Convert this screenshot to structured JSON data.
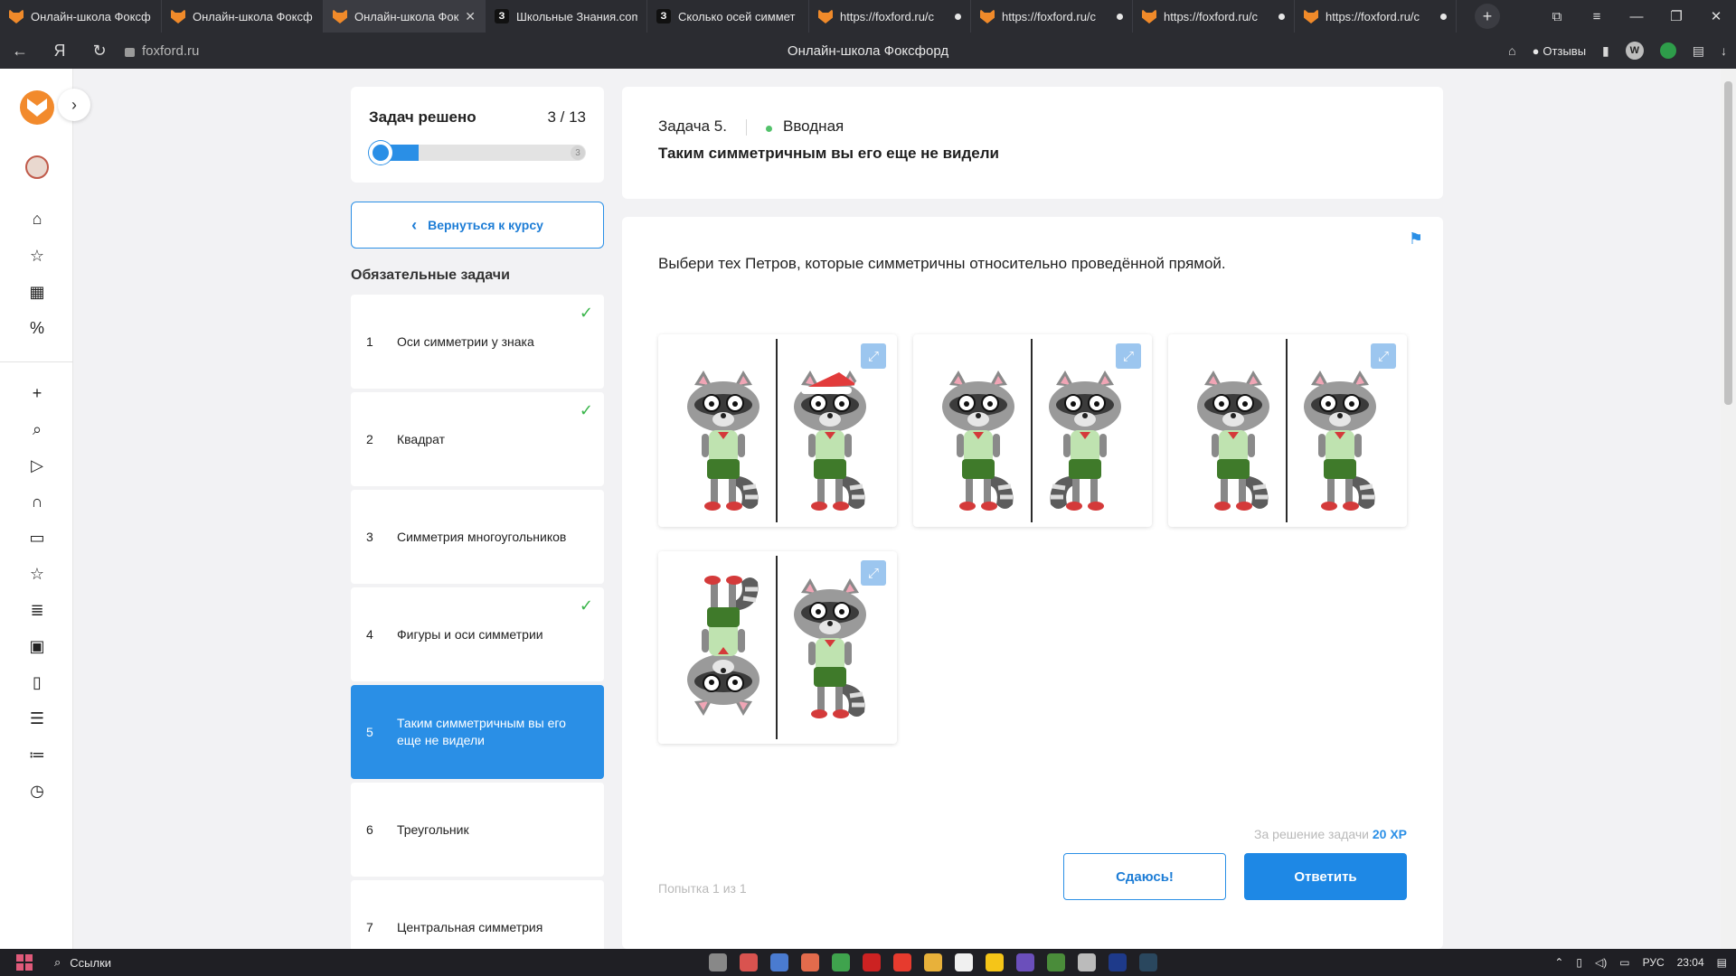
{
  "browser": {
    "tabs": [
      {
        "title": "Онлайн-школа Фоксф",
        "icon": "foxford-icon"
      },
      {
        "title": "Онлайн-школа Фоксф",
        "icon": "foxford-icon"
      },
      {
        "title": "Онлайн-школа Фок",
        "icon": "foxford-icon",
        "active": true
      },
      {
        "title": "Школьные Знания.com",
        "icon": "znanija-icon"
      },
      {
        "title": "Сколько осей симмет",
        "icon": "znanija-icon"
      },
      {
        "title": "https://foxford.ru/c",
        "icon": "foxford-icon"
      },
      {
        "title": "https://foxford.ru/c",
        "icon": "foxford-icon"
      },
      {
        "title": "https://foxford.ru/c",
        "icon": "foxford-icon"
      },
      {
        "title": "https://foxford.ru/c",
        "icon": "foxford-icon"
      }
    ],
    "url": "foxford.ru",
    "page_title": "Онлайн-школа Фоксфорд",
    "reviews_label": "Отзывы",
    "profile_letter": "W"
  },
  "progress": {
    "label": "Задач решено",
    "count": "3 / 13",
    "end_label": "3",
    "fraction": 0.23
  },
  "back_button": "Вернуться к курсу",
  "section_title": "Обязательные задачи",
  "tasks": [
    {
      "num": "1",
      "name": "Оси симметрии у знака",
      "done": true
    },
    {
      "num": "2",
      "name": "Квадрат",
      "done": true
    },
    {
      "num": "3",
      "name": "Симметрия многоугольников",
      "done": false
    },
    {
      "num": "4",
      "name": "Фигуры и оси симметрии",
      "done": true
    },
    {
      "num": "5",
      "name": "Таким симметричным вы его еще не видели",
      "done": false,
      "active": true
    },
    {
      "num": "6",
      "name": "Треугольник",
      "done": false
    },
    {
      "num": "7",
      "name": "Центральная симметрия",
      "done": false
    }
  ],
  "task": {
    "number": "Задача 5.",
    "level": "Вводная",
    "title": "Таким симметричным вы его еще не видели",
    "question": "Выбери тех Петров, которые симметричны относительно проведённой прямой.",
    "options": [
      {
        "variant": "hat-on-right"
      },
      {
        "variant": "mirrored-pair"
      },
      {
        "variant": "same-direction"
      },
      {
        "variant": "upside-down-left"
      }
    ],
    "xp_prefix": "За решение задачи",
    "xp_value": "20 XP",
    "attempt": "Попытка 1 из 1",
    "give_up": "Сдаюсь!",
    "answer": "Ответить"
  },
  "taskbar": {
    "search_label": "Ссылки",
    "lang": "РУС",
    "time": "23:04"
  },
  "colors": {
    "accent": "#2a8fe6",
    "check": "#39b54a",
    "level_dot": "#53c26b"
  }
}
